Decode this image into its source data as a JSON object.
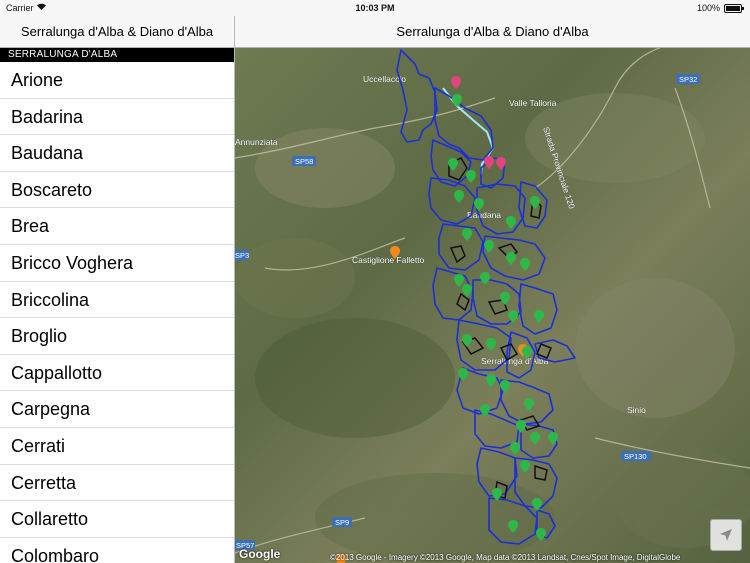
{
  "statusbar": {
    "carrier": "Carrier",
    "time": "10:03 PM",
    "battery": "100%",
    "battery_level": 1.0
  },
  "master": {
    "title": "Serralunga d'Alba & Diano d'Alba",
    "section_header": "SERRALUNGA D'ALBA",
    "items": [
      "Arione",
      "Badarina",
      "Baudana",
      "Boscareto",
      "Brea",
      "Bricco Voghera",
      "Briccolina",
      "Broglio",
      "Cappallotto",
      "Carpegna",
      "Cerrati",
      "Cerretta",
      "Collaretto",
      "Colombaro"
    ]
  },
  "detail": {
    "title": "Serralunga d'Alba & Diano d'Alba",
    "map": {
      "labels": {
        "uccellaccio": "Uccellaccio",
        "valle_talloria": "Valle Talloria",
        "annunziata": "Annunziata",
        "castiglione": "Castiglione Falletto",
        "baudana": "Baudana",
        "serralunga": "Serralunga d'Alba",
        "sinio": "Sinio",
        "strada": "Strada Provinciale 120"
      },
      "roads": {
        "sp32": "SP32",
        "sp58": "SP58",
        "sp3": "SP3",
        "sp130": "SP130",
        "sp9": "SP9",
        "sp57": "SP57"
      },
      "attribution": "©2013 Google - Imagery ©2013 Google, Map data ©2013 Landsat, Cnes/Spot Image, DigitalGlobe",
      "google_logo": "Google"
    }
  },
  "colors": {
    "boundary": "#1c2fd6",
    "highlight": "#9fe8f2",
    "pin_green": "#2fb84a",
    "pin_pink": "#e0457b",
    "pin_orange": "#f08a1c"
  }
}
